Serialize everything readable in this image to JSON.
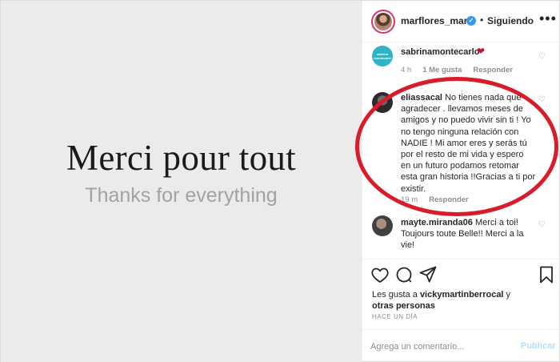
{
  "post": {
    "media_title": "Merci pour tout",
    "media_subtitle": "Thanks for everything"
  },
  "header": {
    "username": "marflores_mar",
    "separator": "•",
    "following_label": "Siguiendo",
    "more_icon": "•••"
  },
  "comments": [
    {
      "username": "sabrinamontecarlo",
      "text": "",
      "meta_time": "4 h",
      "meta_likes": "1 Me gusta",
      "reply_label": "Responder",
      "avatar_text": "sabrina montecarlo"
    },
    {
      "username": "eliassacal",
      "lines": [
        "No tienes nada que",
        "agradecer . llevamos meses de",
        "amigos y no puedo vivir sin ti ! Yo",
        "no tengo ninguna relación con",
        "NADIE ! Mi amor eres y serás tú",
        "por el resto de mi vida y espero",
        "en un futuro podamos retomar",
        "esta gran historia !!Gracias a ti por",
        "existir."
      ],
      "meta_time": "19 m",
      "reply_label": "Responder"
    },
    {
      "username": "mayte.miranda06",
      "lines": [
        "Merci a toi!",
        "Toujours toute Belle!! Merci a la",
        "vie!"
      ]
    }
  ],
  "likes": {
    "prefix": "Les gusta a ",
    "user": "vickymartinberrocal",
    "suffix": " y",
    "others": "otras personas"
  },
  "timestamp": "HACE UN DÍA",
  "add_comment": {
    "placeholder": "Agrega un comentario...",
    "publish_label": "Publicar"
  },
  "colors": {
    "verified": "#3897f0",
    "publish_disabled": "#b2dffc",
    "annotation": "#d91c2a"
  }
}
